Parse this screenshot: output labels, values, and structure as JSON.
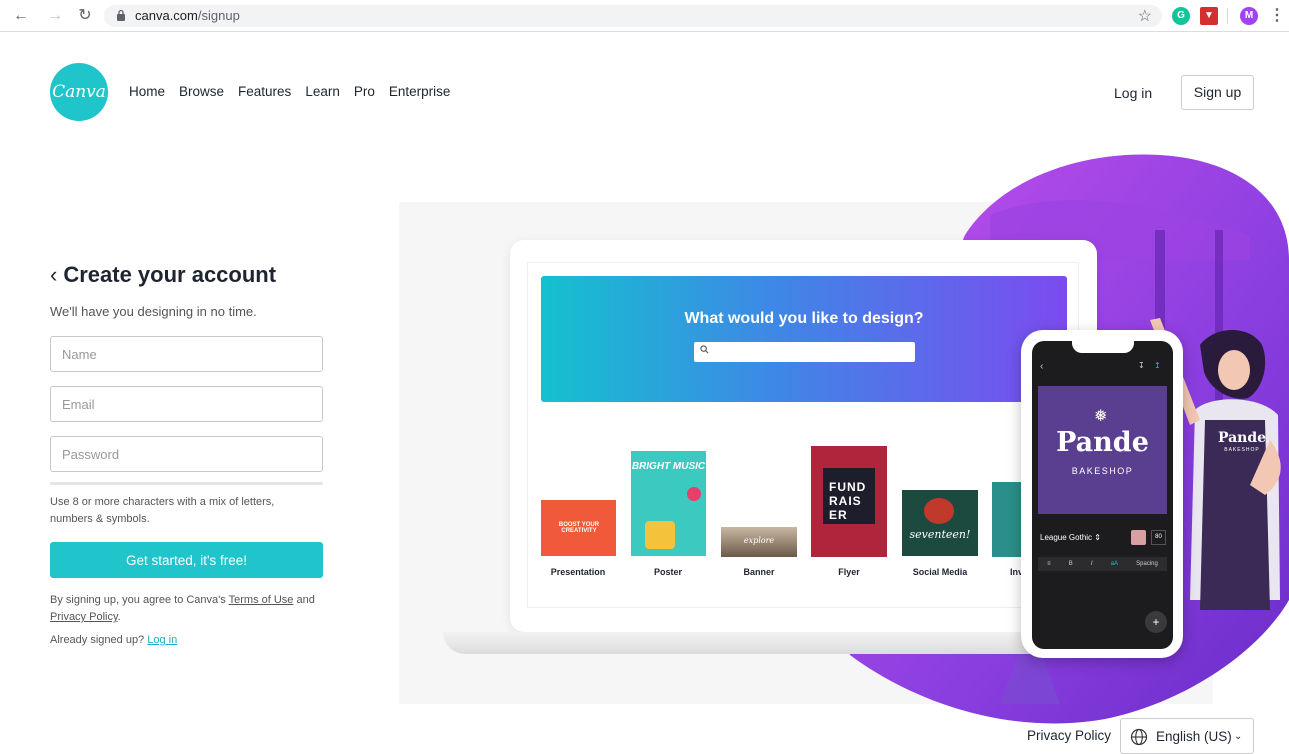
{
  "browser": {
    "url_host": "canva.com",
    "url_path": "/signup",
    "extensions": [
      "G",
      "M"
    ]
  },
  "header": {
    "logo_text": "Canva",
    "nav": [
      "Home",
      "Browse",
      "Features",
      "Learn",
      "Pro",
      "Enterprise"
    ],
    "login_label": "Log in",
    "signup_label": "Sign up"
  },
  "form": {
    "back_icon": "chevron-left-icon",
    "title": "Create your account",
    "subtitle": "We'll have you designing in no time.",
    "name_placeholder": "Name",
    "email_placeholder": "Email",
    "password_placeholder": "Password",
    "password_hint": "Use 8 or more characters with a mix of letters, numbers & symbols.",
    "submit_label": "Get started, it's free!",
    "terms_prefix": "By signing up, you agree to Canva's ",
    "terms_link": "Terms of Use",
    "terms_and": " and ",
    "privacy_link": "Privacy Policy",
    "terms_suffix": ".",
    "already_text": "Already signed up? ",
    "already_link": "Log in"
  },
  "hero": {
    "banner_title": "What would you like to design?",
    "templates": [
      "Presentation",
      "Poster",
      "Banner",
      "Flyer",
      "Social Media",
      "Inv"
    ],
    "tile_texts": {
      "presentation": "BOOST YOUR CREATIVITY",
      "poster": "BRIGHT MUSIC",
      "banner": "explore",
      "flyer": "FUND RAIS ER",
      "social": "seventeen!"
    },
    "phone": {
      "brand": "Pande",
      "brand_sub": "BAKESHOP",
      "font_name": "League Gothic",
      "font_size": "80",
      "spacing_label": "Spacing"
    },
    "apron_brand": "Pande",
    "apron_sub": "BAKESHOP"
  },
  "footer": {
    "privacy_label": "Privacy Policy",
    "language_label": "English (US)"
  },
  "colors": {
    "brand": "#20c4cb",
    "banner_start": "#14c1cf",
    "banner_end": "#7c4bf0",
    "purple": "#8a3ee0"
  }
}
